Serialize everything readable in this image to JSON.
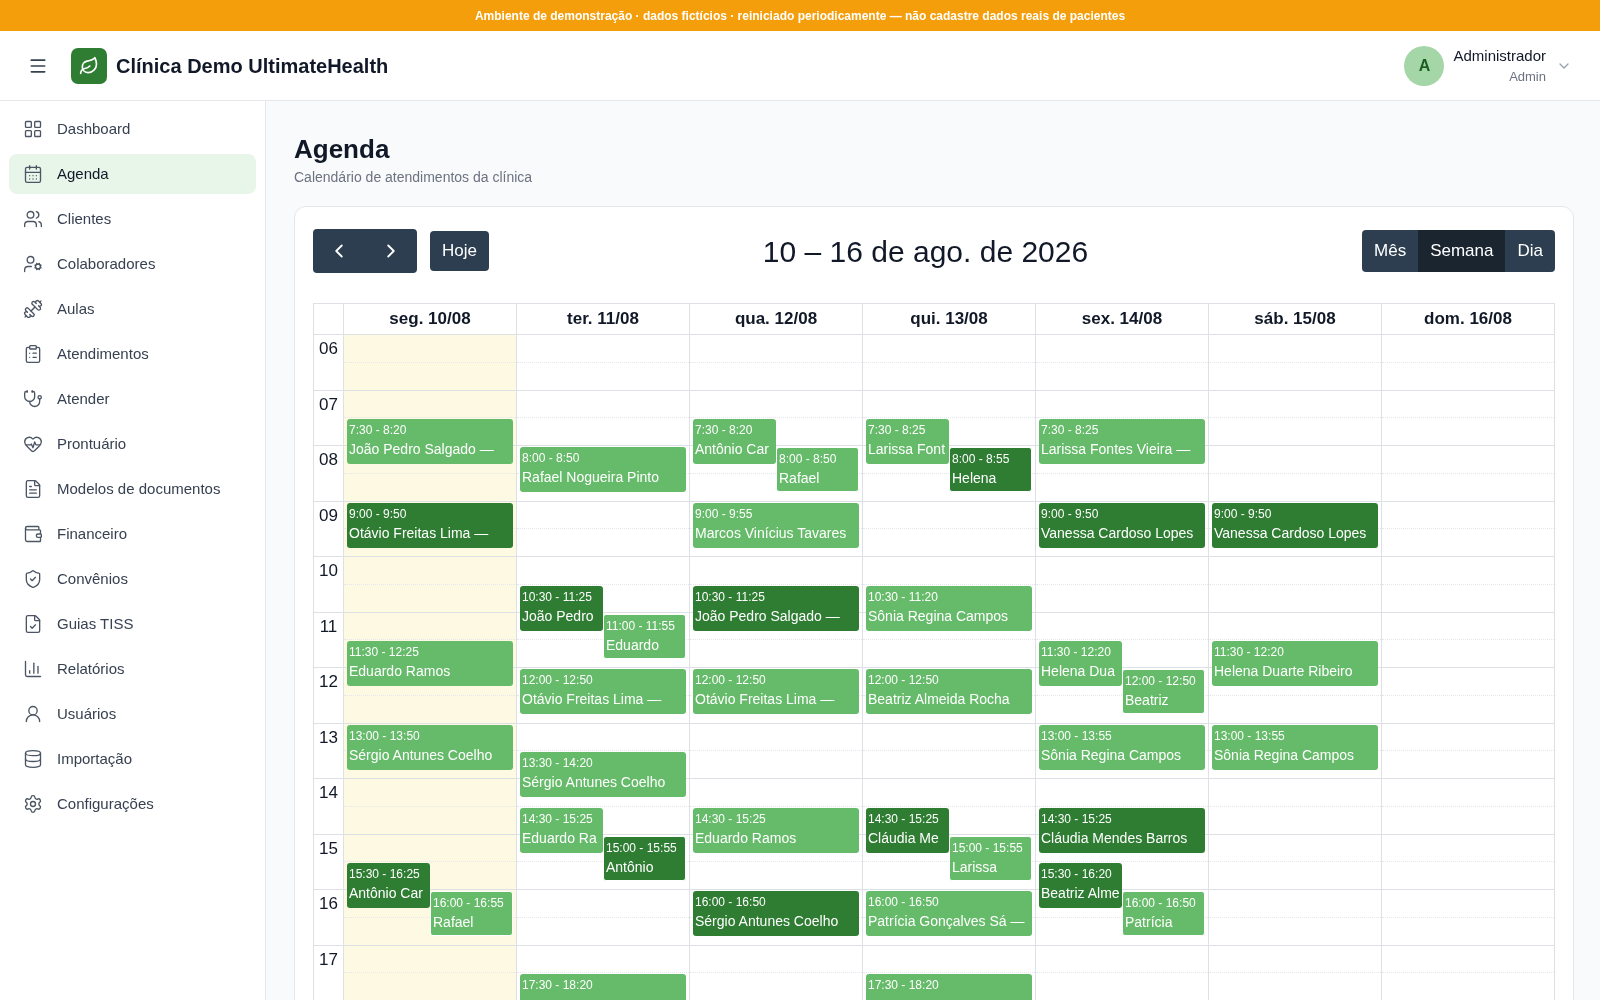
{
  "banner": "Ambiente de demonstração · dados fictícios · reiniciado periodicamente — não cadastre dados reais de pacientes",
  "header": {
    "brand": "Clínica Demo UltimateHealth",
    "user": {
      "initial": "A",
      "name": "Administrador",
      "role": "Admin"
    }
  },
  "sidebar": {
    "items": [
      {
        "label": "Dashboard",
        "selected": false
      },
      {
        "label": "Agenda",
        "selected": true
      },
      {
        "label": "Clientes",
        "selected": false
      },
      {
        "label": "Colaboradores",
        "selected": false
      },
      {
        "label": "Aulas",
        "selected": false
      },
      {
        "label": "Atendimentos",
        "selected": false
      },
      {
        "label": "Atender",
        "selected": false
      },
      {
        "label": "Prontuário",
        "selected": false
      },
      {
        "label": "Modelos de documentos",
        "selected": false
      },
      {
        "label": "Financeiro",
        "selected": false
      },
      {
        "label": "Convênios",
        "selected": false
      },
      {
        "label": "Guias TISS",
        "selected": false
      },
      {
        "label": "Relatórios",
        "selected": false
      },
      {
        "label": "Usuários",
        "selected": false
      },
      {
        "label": "Importação",
        "selected": false
      },
      {
        "label": "Configurações",
        "selected": false
      }
    ]
  },
  "page": {
    "title": "Agenda",
    "subtitle": "Calendário de atendimentos da clínica"
  },
  "calendar": {
    "today_button": "Hoje",
    "range_title": "10 – 16 de ago. de 2026",
    "views": [
      {
        "label": "Mês",
        "selected": false
      },
      {
        "label": "Semana",
        "selected": true
      },
      {
        "label": "Dia",
        "selected": false
      }
    ],
    "hours": [
      "06",
      "07",
      "08",
      "09",
      "10",
      "11",
      "12",
      "13",
      "14",
      "15",
      "16",
      "17"
    ],
    "days": [
      {
        "label": "seg. 10/08",
        "today": true,
        "events": [
          {
            "time": "7:30 - 8:20",
            "name": "João Pedro Salgado —",
            "color": "#66bb6a",
            "overlapping": false
          },
          {
            "time": "9:00 - 9:50",
            "name": "Otávio Freitas Lima —",
            "color": "#2e7d32",
            "overlapping": false
          },
          {
            "time": "11:30 - 12:25",
            "name": "Eduardo Ramos",
            "color": "#66bb6a",
            "overlapping": false
          },
          {
            "time": "13:00 - 13:50",
            "name": "Sérgio Antunes Coelho",
            "color": "#66bb6a",
            "overlapping": false
          },
          {
            "time": "15:30 - 16:25",
            "name": "Antônio Car",
            "color": "#2e7d32",
            "overlapping": false
          },
          {
            "time": "16:00 - 16:55",
            "name": "Rafael",
            "color": "#66bb6a",
            "overlapping": true
          }
        ]
      },
      {
        "label": "ter. 11/08",
        "today": false,
        "events": [
          {
            "time": "8:00 - 8:50",
            "name": "Rafael Nogueira Pinto",
            "color": "#66bb6a",
            "overlapping": false
          },
          {
            "time": "10:30 - 11:25",
            "name": "João Pedro",
            "color": "#2e7d32",
            "overlapping": false
          },
          {
            "time": "11:00 - 11:55",
            "name": "Eduardo",
            "color": "#66bb6a",
            "overlapping": true
          },
          {
            "time": "12:00 - 12:50",
            "name": "Otávio Freitas Lima —",
            "color": "#66bb6a",
            "overlapping": false
          },
          {
            "time": "13:30 - 14:20",
            "name": "Sérgio Antunes Coelho",
            "color": "#66bb6a",
            "overlapping": false
          },
          {
            "time": "14:30 - 15:25",
            "name": "Eduardo Ra",
            "color": "#66bb6a",
            "overlapping": false
          },
          {
            "time": "15:00 - 15:55",
            "name": "Antônio",
            "color": "#2e7d32",
            "overlapping": true
          },
          {
            "time": "17:30 - 18:20",
            "color": "#66bb6a",
            "overlapping": false
          }
        ]
      },
      {
        "label": "qua. 12/08",
        "today": false,
        "events": [
          {
            "time": "7:30 - 8:20",
            "name": "Antônio Car",
            "color": "#66bb6a",
            "overlapping": false
          },
          {
            "time": "8:00 - 8:50",
            "name": "Rafael",
            "color": "#66bb6a",
            "overlapping": true
          },
          {
            "time": "9:00 - 9:55",
            "name": "Marcos Vinícius Tavares",
            "color": "#66bb6a",
            "overlapping": false
          },
          {
            "time": "10:30 - 11:25",
            "name": "João Pedro Salgado —",
            "color": "#2e7d32",
            "overlapping": false
          },
          {
            "time": "12:00 - 12:50",
            "name": "Otávio Freitas Lima —",
            "color": "#66bb6a",
            "overlapping": false
          },
          {
            "time": "14:30 - 15:25",
            "name": "Eduardo Ramos",
            "color": "#66bb6a",
            "overlapping": false
          },
          {
            "time": "16:00 - 16:50",
            "name": "Sérgio Antunes Coelho",
            "color": "#2e7d32",
            "overlapping": false
          }
        ]
      },
      {
        "label": "qui. 13/08",
        "today": false,
        "events": [
          {
            "time": "7:30 - 8:25",
            "name": "Larissa Font",
            "color": "#66bb6a",
            "overlapping": false
          },
          {
            "time": "8:00 - 8:55",
            "name": "Helena",
            "color": "#2e7d32",
            "overlapping": true
          },
          {
            "time": "10:30 - 11:20",
            "name": "Sônia Regina Campos",
            "color": "#66bb6a",
            "overlapping": false
          },
          {
            "time": "12:00 - 12:50",
            "name": "Beatriz Almeida Rocha",
            "color": "#66bb6a",
            "overlapping": false
          },
          {
            "time": "14:30 - 15:25",
            "name": "Cláudia Me",
            "color": "#2e7d32",
            "overlapping": false
          },
          {
            "time": "15:00 - 15:55",
            "name": "Larissa",
            "color": "#66bb6a",
            "overlapping": true
          },
          {
            "time": "16:00 - 16:50",
            "name": "Patrícia Gonçalves Sá —",
            "color": "#66bb6a",
            "overlapping": false
          },
          {
            "time": "17:30 - 18:20",
            "color": "#66bb6a",
            "overlapping": false
          }
        ]
      },
      {
        "label": "sex. 14/08",
        "today": false,
        "events": [
          {
            "time": "7:30 - 8:25",
            "name": "Larissa Fontes Vieira —",
            "color": "#66bb6a",
            "overlapping": false
          },
          {
            "time": "9:00 - 9:50",
            "name": "Vanessa Cardoso Lopes",
            "color": "#2e7d32",
            "overlapping": false
          },
          {
            "time": "11:30 - 12:20",
            "name": "Helena Dua",
            "color": "#66bb6a",
            "overlapping": false
          },
          {
            "time": "12:00 - 12:50",
            "name": "Beatriz",
            "color": "#66bb6a",
            "overlapping": true
          },
          {
            "time": "13:00 - 13:55",
            "name": "Sônia Regina Campos",
            "color": "#66bb6a",
            "overlapping": false
          },
          {
            "time": "14:30 - 15:25",
            "name": "Cláudia Mendes Barros",
            "color": "#2e7d32",
            "overlapping": false
          },
          {
            "time": "15:30 - 16:20",
            "name": "Beatriz Alme",
            "color": "#2e7d32",
            "overlapping": false
          },
          {
            "time": "16:00 - 16:50",
            "name": "Patrícia",
            "color": "#66bb6a",
            "overlapping": true
          }
        ]
      },
      {
        "label": "sáb. 15/08",
        "today": false,
        "events": [
          {
            "time": "9:00 - 9:50",
            "name": "Vanessa Cardoso Lopes",
            "color": "#2e7d32",
            "overlapping": false
          },
          {
            "time": "11:30 - 12:20",
            "name": "Helena Duarte Ribeiro",
            "color": "#66bb6a",
            "overlapping": false
          },
          {
            "time": "13:00 - 13:55",
            "name": "Sônia Regina Campos",
            "color": "#66bb6a",
            "overlapping": false
          }
        ]
      },
      {
        "label": "dom. 16/08",
        "today": false
      }
    ]
  }
}
